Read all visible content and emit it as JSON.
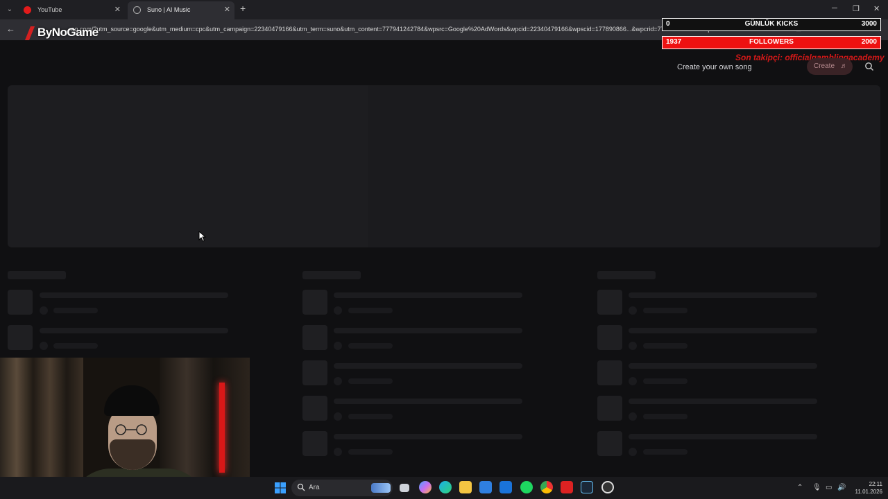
{
  "browser": {
    "tabs": [
      {
        "title": "YouTube",
        "active": false
      },
      {
        "title": "Suno | AI Music",
        "active": true
      }
    ],
    "url": "...ao.com/?utm_source=google&utm_medium=cpc&utm_campaign=22340479166&utm_term=suno&utm_content=777941242784&wpsrc=Google%20AdWords&wpcid=22340479166&wpscid=177890866...&wpcrid=777941242784&wpkwn=su"
  },
  "overlay": {
    "logo": "ByNoGame",
    "kicks": {
      "current": "0",
      "label": "GÜNLÜK KICKS",
      "goal": "3000"
    },
    "followers": {
      "current": "1937",
      "label": "FOLLOWERS",
      "goal": "2000"
    },
    "last_follower": "Son takipçi: officialgamblingacademy"
  },
  "page": {
    "create_song_prompt": "Create your own song",
    "create_button": "Create"
  },
  "taskbar": {
    "search_label": "Ara",
    "time": "22:11",
    "date": "11.01.2026"
  },
  "colors": {
    "accent_red": "#ee1111",
    "background": "#101012"
  }
}
